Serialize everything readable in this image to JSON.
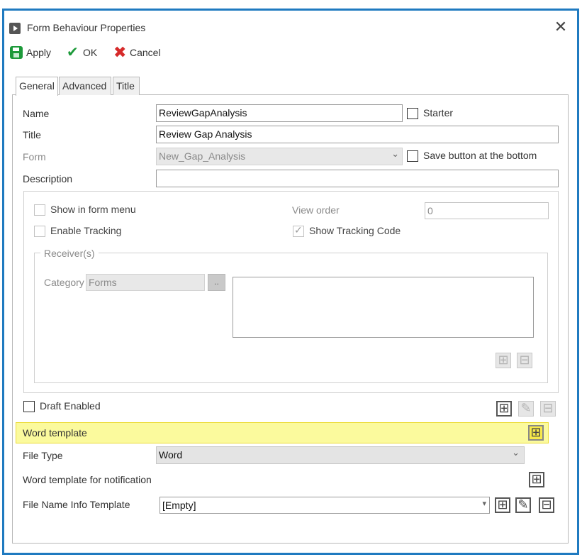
{
  "dialog": {
    "title": "Form Behaviour Properties",
    "close_glyph": "✕"
  },
  "toolbar": {
    "apply_label": "Apply",
    "ok_label": "OK",
    "cancel_label": "Cancel"
  },
  "tabs": [
    {
      "label": "General",
      "active": true
    },
    {
      "label": "Advanced",
      "active": false
    },
    {
      "label": "Title",
      "active": false
    }
  ],
  "general": {
    "name_label": "Name",
    "name_value": "ReviewGapAnalysis",
    "starter_label": "Starter",
    "title_label": "Title",
    "title_value": "Review Gap Analysis",
    "form_label": "Form",
    "form_value": "New_Gap_Analysis",
    "save_bottom_label": "Save button at the bottom",
    "description_label": "Description",
    "description_value": "",
    "show_menu_label": "Show in form menu",
    "enable_tracking_label": "Enable Tracking",
    "view_order_label": "View order",
    "view_order_value": "0",
    "show_tracking_code_label": "Show Tracking Code",
    "receivers_legend": "Receiver(s)",
    "category_label": "Category",
    "category_value": "Forms",
    "dots_label": "..",
    "draft_enabled_label": "Draft Enabled",
    "word_template_label": "Word template",
    "file_type_label": "File Type",
    "file_type_value": "Word",
    "word_template_notification_label": "Word template for notification",
    "file_name_info_label": "File Name Info Template",
    "file_name_info_value": "[Empty]"
  },
  "glyphs": {
    "plus": "⊞",
    "minus": "⊟",
    "edit": "✎",
    "chevron": "⌄",
    "small_arrow": "▾"
  },
  "colors": {
    "frame_border": "#1f7ac0",
    "highlight": "#fbfa9d",
    "apply_green": "#1d9a3a",
    "cancel_red": "#d62a2a"
  }
}
